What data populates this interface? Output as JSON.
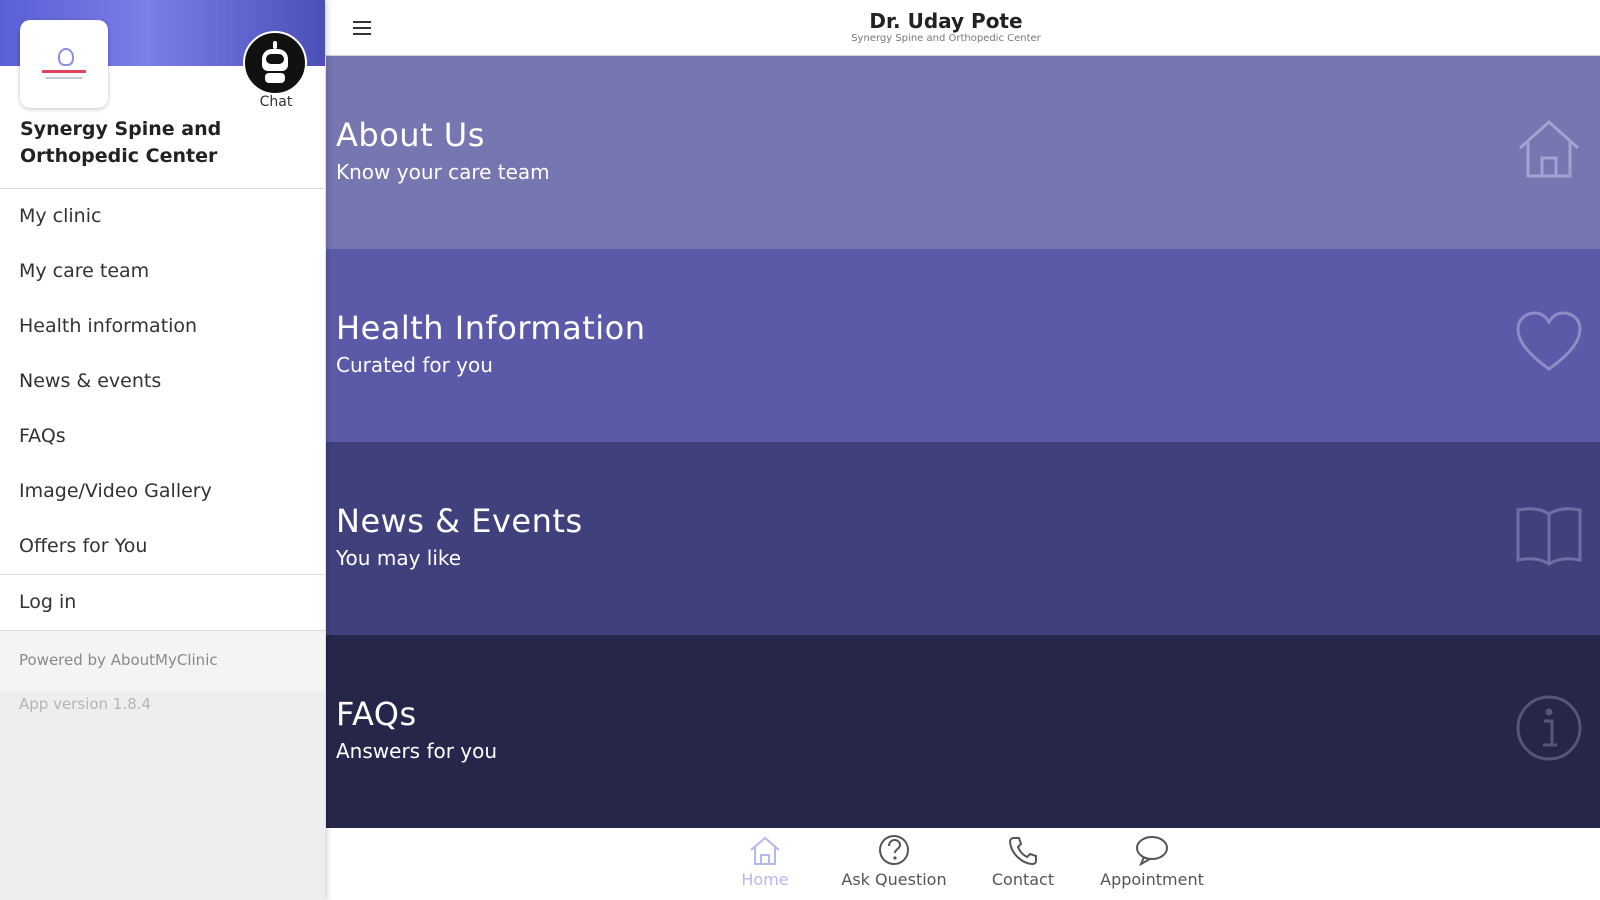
{
  "drawer": {
    "clinic_name_line1": "Synergy Spine and",
    "clinic_name_line2": "Orthopedic Center",
    "chat_label": "Chat",
    "logo_icon": "clinic-logo",
    "chat_icon": "chatbot-icon",
    "menu_items": [
      {
        "label": "My clinic"
      },
      {
        "label": "My care team"
      },
      {
        "label": "Health information"
      },
      {
        "label": "News & events"
      },
      {
        "label": "FAQs"
      },
      {
        "label": "Image/Video Gallery"
      },
      {
        "label": "Offers for You"
      }
    ],
    "login_label": "Log in",
    "powered_by": "Powered by AboutMyClinic",
    "app_version": "App version 1.8.4"
  },
  "header": {
    "title": "Dr. Uday Pote",
    "subtitle": "Synergy Spine and Orthopedic Center",
    "menu_icon": "hamburger-icon"
  },
  "tiles": [
    {
      "title": "About Us",
      "subtitle": "Know your care team",
      "icon": "home-icon",
      "color": "#7676b0"
    },
    {
      "title": "Health Information",
      "subtitle": "Curated for you",
      "icon": "heart-icon",
      "color": "#5a5aa8"
    },
    {
      "title": "News & Events",
      "subtitle": "You may like",
      "icon": "book-icon",
      "color": "#40417c"
    },
    {
      "title": "FAQs",
      "subtitle": "Answers for you",
      "icon": "info-icon",
      "color": "#26264a"
    }
  ],
  "bottom_nav": [
    {
      "label": "Home",
      "icon": "home-icon",
      "active": true
    },
    {
      "label": "Ask Question",
      "icon": "question-icon",
      "active": false
    },
    {
      "label": "Contact",
      "icon": "phone-icon",
      "active": false
    },
    {
      "label": "Appointment",
      "icon": "chat-bubble-icon",
      "active": false
    }
  ],
  "colors": {
    "brand_banner": "#6a6ee0",
    "active_nav": "#b7b7f0"
  }
}
